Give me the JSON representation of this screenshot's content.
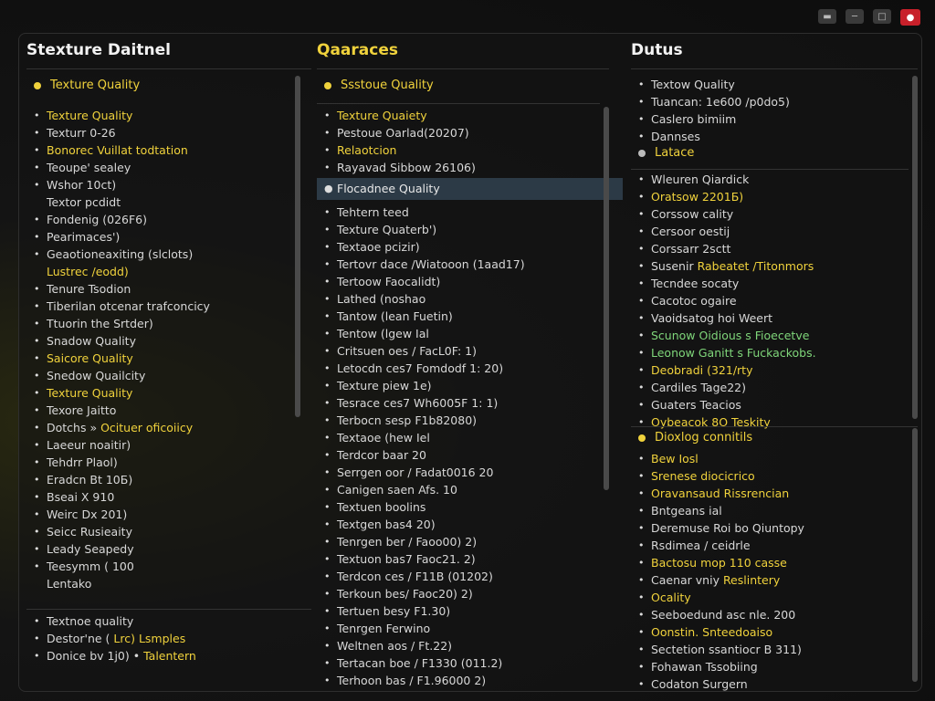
{
  "titlebar": {
    "icons": [
      "minimize-icon",
      "restore-icon",
      "window-icon",
      "close-icon"
    ]
  },
  "col1": {
    "title": "Stexture Daitnel",
    "header": "Texture Quality",
    "items": [
      {
        "t": "Texture Quality",
        "c": "y"
      },
      {
        "t": "Texturr 0-26",
        "c": ""
      },
      {
        "t": "Bonorec Vuillat todtation",
        "c": "y"
      },
      {
        "t": "Teoupe' sealey",
        "c": ""
      },
      {
        "t": "Wshor 10ct)",
        "c": ""
      },
      {
        "t": "Textor pcdidt",
        "c": "",
        "nob": true
      },
      {
        "t": "Fondenig (026F6)",
        "c": ""
      },
      {
        "t": "Pearimaces')",
        "c": ""
      },
      {
        "t": "Geaotioneaxiting (slclots)",
        "c": ""
      },
      {
        "t": "Lustrec /eodd)",
        "c": "y",
        "nob": true
      },
      {
        "t": "Tenure Tsodion",
        "c": ""
      },
      {
        "t": "Tiberilan otcenar trafconcicy",
        "c": ""
      },
      {
        "t": "Ttuorin the Srtder)",
        "c": ""
      },
      {
        "t": "Snadow Quality",
        "c": ""
      },
      {
        "t": "Saicore Quality",
        "c": "y"
      },
      {
        "t": "Snedow Quailcity",
        "c": ""
      },
      {
        "t": "Texture Quality",
        "c": "y"
      },
      {
        "t": "Texore Jaitto",
        "c": ""
      },
      {
        "t": "Dotchs » Ocituer oficoiicy",
        "c": "mix",
        "pre": "Dotchs » ",
        "hl": "Ocituer oficoiicy"
      },
      {
        "t": "Laeeur noaitir)",
        "c": ""
      },
      {
        "t": "Tehdrr Plaol)",
        "c": ""
      },
      {
        "t": "Eradcn Bt 10Б)",
        "c": ""
      },
      {
        "t": "Bseai X 910",
        "c": ""
      },
      {
        "t": "Weirc Dx 201)",
        "c": ""
      },
      {
        "t": "Seicc Rusieaity",
        "c": ""
      },
      {
        "t": "Leady Seapedy",
        "c": ""
      },
      {
        "t": "Teesymm ( 100",
        "c": ""
      },
      {
        "t": "Lentako",
        "c": "",
        "nob": true
      }
    ],
    "footer": [
      {
        "t": "Textnoe quality",
        "c": ""
      },
      {
        "t": "Destor'ne ( Lrc) Lsmples",
        "c": "mix",
        "pre": "Destor'ne ( ",
        "hl": "Lrc) Lsmples"
      },
      {
        "t": "Donice bv 1j0) • Talentern",
        "c": "mix",
        "pre": "Donice bv 1j0) • ",
        "hl": "Talentern"
      }
    ]
  },
  "col2": {
    "title": "Qaaraces",
    "header": "Ssstoue Quality",
    "items_top": [
      {
        "t": "Texture Quaiety",
        "c": "y"
      },
      {
        "t": "Pestoue Oarlad(20207)",
        "c": ""
      },
      {
        "t": "Relaotcion",
        "c": "y"
      },
      {
        "t": "Rayavad Sibbow 26106)",
        "c": ""
      }
    ],
    "selected": "Flocadnee Quality",
    "items": [
      {
        "t": "Tehtern teed",
        "c": ""
      },
      {
        "t": "Texture Quaterb')",
        "c": ""
      },
      {
        "t": "Textaoe pcizir)",
        "c": ""
      },
      {
        "t": "Tertovr dace /Wiatooon (1aad17)",
        "c": ""
      },
      {
        "t": "Tertoow Faocalidt)",
        "c": ""
      },
      {
        "t": "Lathed (noshao",
        "c": ""
      },
      {
        "t": "Tantow (lean Fuetin)",
        "c": ""
      },
      {
        "t": "Tentow (lgew Ial",
        "c": ""
      },
      {
        "t": "Critsuen oes / FacL0F: 1)",
        "c": ""
      },
      {
        "t": "Letocdn ces7 Fomdodf 1: 20)",
        "c": ""
      },
      {
        "t": "Texture piew 1e)",
        "c": ""
      },
      {
        "t": "Tesrace ces7 Wh6005F 1: 1)",
        "c": ""
      },
      {
        "t": "Terbocn sesp F1b82080)",
        "c": ""
      },
      {
        "t": "Textaoe (hew Iel",
        "c": ""
      },
      {
        "t": "Terdcor baar 20",
        "c": ""
      },
      {
        "t": "Serrgen oor / Fadat0016 20",
        "c": ""
      },
      {
        "t": "Canigen saen Afs. 10",
        "c": ""
      },
      {
        "t": "Textuen boolins",
        "c": ""
      },
      {
        "t": "Textgen bas4 20)",
        "c": ""
      },
      {
        "t": "Tenrgen ber / Faoo00) 2)",
        "c": ""
      },
      {
        "t": "Textuon bas7 Faoc21. 2)",
        "c": ""
      },
      {
        "t": "Terdcon ces / F11B (01202)",
        "c": ""
      },
      {
        "t": "Terkoun bes/ Faoc20) 2)",
        "c": ""
      },
      {
        "t": "Tertuen besy F1.30)",
        "c": ""
      },
      {
        "t": "Tenrgen Ferwino",
        "c": ""
      },
      {
        "t": "Weltnen aos / Ft.22)",
        "c": ""
      },
      {
        "t": "Tertacan boe / F1330 (011.2)",
        "c": ""
      },
      {
        "t": "Terhoon bas / F1.96000 2)",
        "c": ""
      }
    ]
  },
  "col3": {
    "title": "Dutus",
    "items_top": [
      {
        "t": "Textow Quality",
        "c": ""
      },
      {
        "t": "Tuancan: 1e600 /p0do5)",
        "c": ""
      },
      {
        "t": "Caslero bimiim",
        "c": ""
      },
      {
        "t": "Dannses",
        "c": ""
      }
    ],
    "header2": "Latace",
    "items_mid": [
      {
        "t": "Wleuren Qiardick",
        "c": ""
      },
      {
        "t": "Oratsow 2201Б)",
        "c": "y"
      },
      {
        "t": "Corssow cality",
        "c": ""
      },
      {
        "t": "Cersoor oestij",
        "c": ""
      },
      {
        "t": "Corssarr 2sctt",
        "c": ""
      },
      {
        "t": "Susenir Rabeatet /Titonmors",
        "c": "mix",
        "pre": "Susenir ",
        "hl": "Rabeatet /Titonmors"
      },
      {
        "t": "Tecndee socaty",
        "c": ""
      },
      {
        "t": "Cacotoc ogaire",
        "c": ""
      },
      {
        "t": "Vaoidsatog hoi Weert",
        "c": ""
      },
      {
        "t": "Scunow Oidious s Fioecetve",
        "c": "g"
      },
      {
        "t": "Leonow Ganitt s Fuckackobs.",
        "c": "g"
      },
      {
        "t": "Deobradi (321/rty",
        "c": "y"
      },
      {
        "t": "Cardiles Tage22)",
        "c": ""
      },
      {
        "t": "Guaters Teacios",
        "c": ""
      },
      {
        "t": "Oybeacok 8O Teskity",
        "c": "y"
      }
    ],
    "header3": "Dioxlog connitils",
    "items_bot": [
      {
        "t": "Bew Iosl",
        "c": "y"
      },
      {
        "t": "Srenese diocicrico",
        "c": "y"
      },
      {
        "t": "Oravansaud Rissrencian",
        "c": "y"
      },
      {
        "t": "Bntgeans ial",
        "c": ""
      },
      {
        "t": "Deremuse Roi bo Qiuntopy",
        "c": ""
      },
      {
        "t": "Rsdimea / ceidrle",
        "c": ""
      },
      {
        "t": "Bactosu mop 110 casse",
        "c": "y"
      },
      {
        "t": "Caenar vniy Reslintery",
        "c": "mix",
        "pre": "Caenar vniy ",
        "hl": "Reslintery"
      },
      {
        "t": "Ocality",
        "c": "y"
      },
      {
        "t": "Seeboedund asc nle. 200",
        "c": ""
      },
      {
        "t": "Oonstin. Snteedoaiso",
        "c": "y"
      },
      {
        "t": "Sectetion ssantiocr B 311)",
        "c": ""
      },
      {
        "t": "Fohawan Tssobiing",
        "c": ""
      },
      {
        "t": "Codaton Surgern",
        "c": ""
      }
    ]
  }
}
